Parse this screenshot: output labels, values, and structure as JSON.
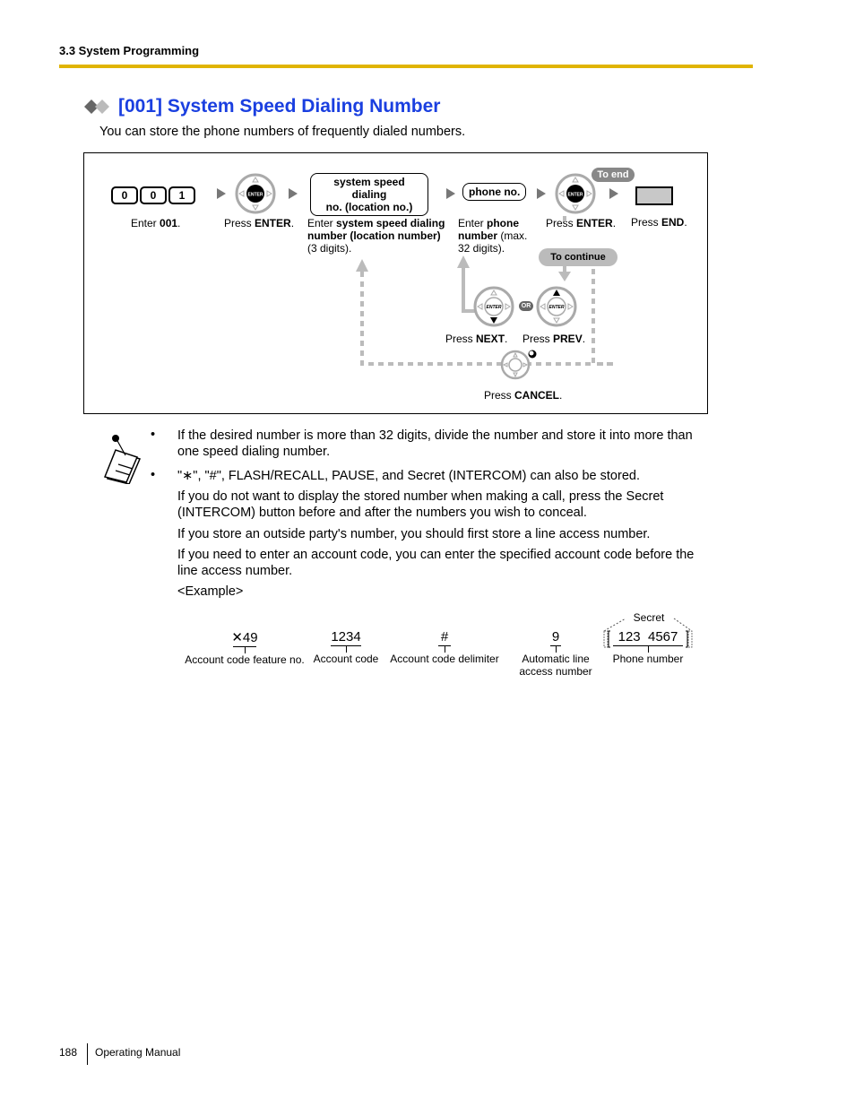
{
  "header": {
    "section": "3.3 System Programming",
    "rule_color": "#e0b400"
  },
  "title": {
    "text": "[001] System Speed Dialing Number",
    "color": "#1a3fe0",
    "icon": "double-diamond-icon"
  },
  "intro": "You can store the phone numbers of frequently dialed numbers.",
  "flow": {
    "keys": [
      "0",
      "0",
      "1"
    ],
    "step1": {
      "pre": "Enter ",
      "bold": "001",
      "post": "."
    },
    "step2": {
      "pre": "Press ",
      "bold": "ENTER",
      "post": "."
    },
    "step3_box": [
      "system speed dialing",
      "no. (location no.)"
    ],
    "step3": {
      "pre": "Enter ",
      "bold": "system speed dialing number (location number)",
      "post": " (3 digits)."
    },
    "step4_box": "phone no.",
    "step4": {
      "pre": "Enter ",
      "bold": "phone number",
      "post": " (max. 32 digits)."
    },
    "step5": {
      "pre": "Press ",
      "bold": "ENTER",
      "post": "."
    },
    "step6": {
      "pre": "Press ",
      "bold": "END",
      "post": "."
    },
    "to_end": "To end",
    "to_continue": "To continue",
    "enter_glyph": "ENTER",
    "or": "OR",
    "next": {
      "pre": "Press ",
      "bold": "NEXT",
      "post": "."
    },
    "prev": {
      "pre": "Press ",
      "bold": "PREV",
      "post": "."
    },
    "cancel": {
      "pre": "Press ",
      "bold": "CANCEL",
      "post": "."
    }
  },
  "notes": {
    "icon": "memo-note-icon",
    "bullet": "•",
    "items": [
      [
        "If the desired number is more than 32 digits, divide the number and store it into more than",
        "one speed dialing number."
      ],
      [
        "\"∗\", \"#\", FLASH/RECALL, PAUSE, and Secret (INTERCOM) can also be stored."
      ]
    ],
    "paras": [
      [
        "If you do not want to display the stored number when making a call, press the Secret",
        "(INTERCOM) button before and after the numbers you wish to conceal."
      ],
      [
        "If you store an outside party's number, you should first store a line access number."
      ],
      [
        "If you need to enter an account code, you can enter the specified account code before the",
        "line access number."
      ],
      [
        "<Example>"
      ]
    ]
  },
  "example": {
    "secret_label": "Secret",
    "items": [
      {
        "value": "✕49",
        "label": [
          "Account code feature no."
        ]
      },
      {
        "value": "1234",
        "label": [
          "Account code"
        ]
      },
      {
        "value": "#",
        "label": [
          "Account code delimiter"
        ]
      },
      {
        "value": "9",
        "label": [
          "Automatic line",
          "access number"
        ]
      },
      {
        "value": "123  4567",
        "label": [
          "Phone number"
        ]
      }
    ]
  },
  "footer": {
    "page": "188",
    "doc": "Operating Manual"
  }
}
